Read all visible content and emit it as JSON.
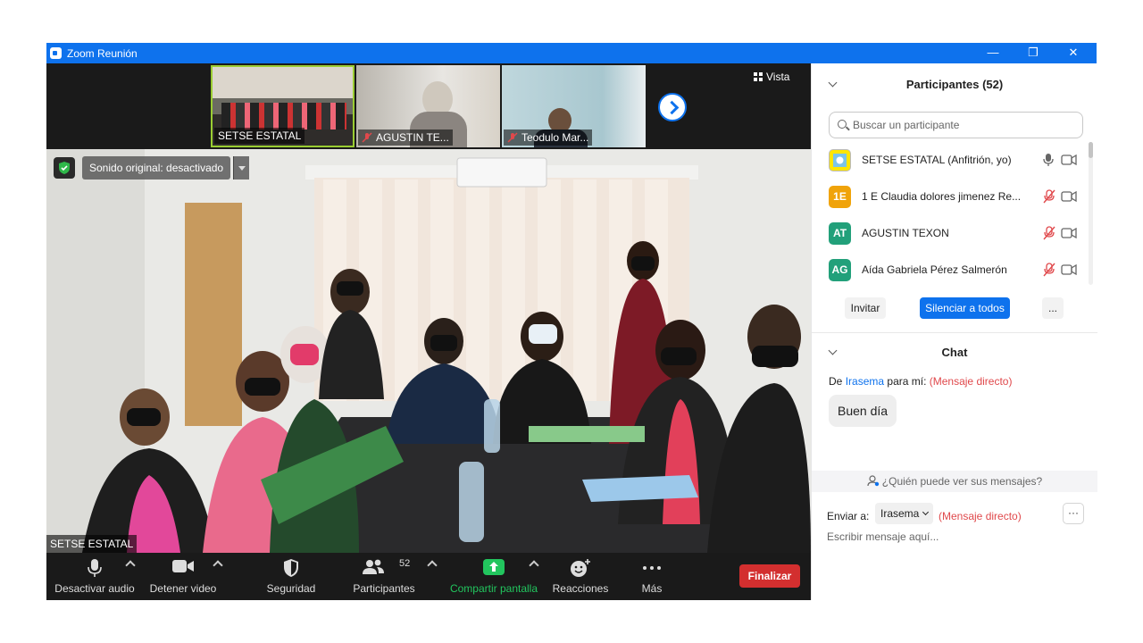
{
  "window": {
    "title": "Zoom Reunión",
    "minimize": "—",
    "restore": "❐",
    "close": "✕"
  },
  "thumbnails": [
    {
      "name": "SETSE ESTATAL",
      "muted": false
    },
    {
      "name": "AGUSTIN TE...",
      "muted": true
    },
    {
      "name": "Teodulo Mar...",
      "muted": true
    }
  ],
  "view_label": "Vista",
  "main_video": {
    "original_sound": "Sonido original: desactivado",
    "speaker_name": "SETSE ESTATAL"
  },
  "toolbar": {
    "mute": "Desactivar audio",
    "stop_video": "Detener video",
    "security": "Seguridad",
    "participants": "Participantes",
    "participants_count": "52",
    "share": "Compartir pantalla",
    "reactions": "Reacciones",
    "more": "Más",
    "end": "Finalizar"
  },
  "participants_panel": {
    "title": "Participantes (52)",
    "search_placeholder": "Buscar un participante",
    "list": [
      {
        "initials": "",
        "name": "SETSE ESTATAL (Anfitrión, yo)",
        "color": "#ffe600",
        "muted": false
      },
      {
        "initials": "1E",
        "name": "1 E Claudia dolores jimenez Re...",
        "color": "#f0a30a",
        "muted": true
      },
      {
        "initials": "AT",
        "name": "AGUSTIN TEXON",
        "color": "#22a07a",
        "muted": true
      },
      {
        "initials": "AG",
        "name": "Aída Gabriela Pérez Salmerón",
        "color": "#22a07a",
        "muted": true
      }
    ],
    "invite": "Invitar",
    "mute_all": "Silenciar a todos",
    "more": "..."
  },
  "chat": {
    "title": "Chat",
    "from_prefix": "De",
    "from_name": "Irasema",
    "to_me": "para mí:",
    "direct_tag": "(Mensaje directo)",
    "message": "Buen día",
    "who_can_see": "¿Quién puede ver sus mensajes?",
    "send_to_label": "Enviar a:",
    "send_to_value": "Irasema",
    "send_direct": "(Mensaje directo)",
    "more": "···",
    "input_placeholder": "Escribir mensaje aquí..."
  },
  "colors": {
    "zoom_blue": "#0e72ed",
    "end_red": "#d32f2f",
    "share_green": "#22c55e",
    "direct_red": "#e0484b"
  }
}
